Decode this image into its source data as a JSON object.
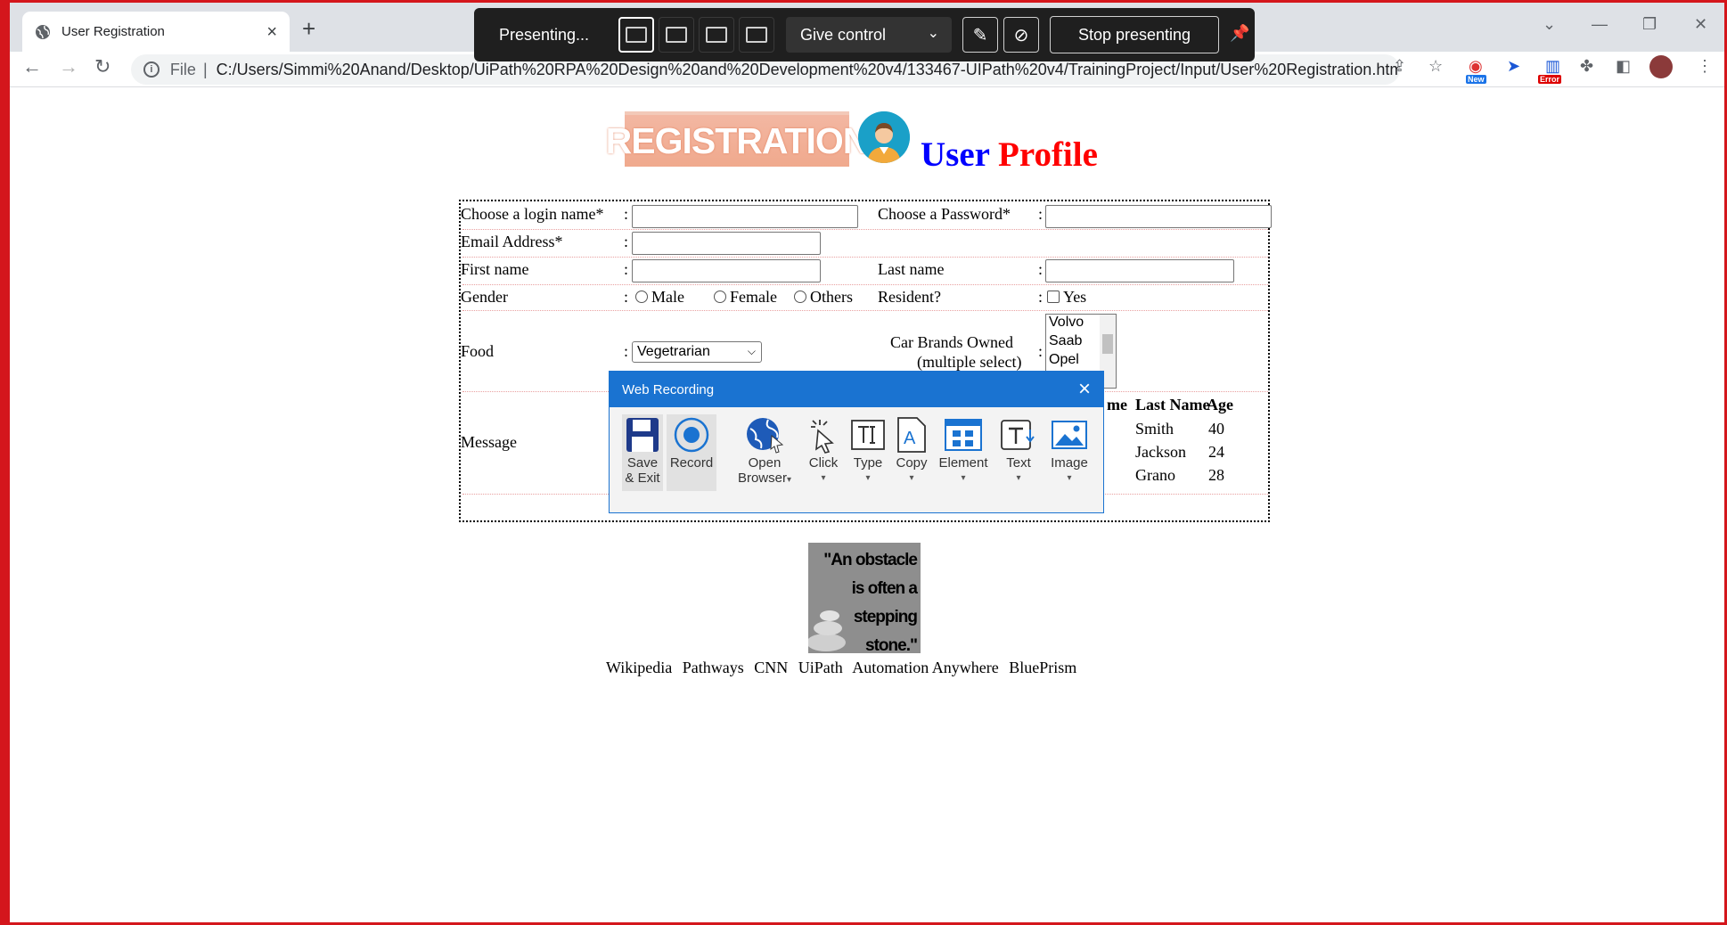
{
  "browser": {
    "tab_title": "User Registration",
    "new_tab": "+",
    "file_label": "File",
    "url": "C:/Users/Simmi%20Anand/Desktop/UiPath%20RPA%20Design%20and%20Development%20v4/133467-UIPath%20v4/TrainingProject/Input/User%20Registration.html",
    "ext_new_badge": "New",
    "ext_error_badge": "Error"
  },
  "presenting": {
    "status": "Presenting...",
    "give_control": "Give control",
    "stop": "Stop presenting"
  },
  "page": {
    "banner": "REGISTRATION",
    "title_word1": "User",
    "title_word2": "Profile",
    "form": {
      "login_label": "Choose a login name*",
      "password_label": "Choose a Password*",
      "email_label": "Email Address*",
      "first_name_label": "First name",
      "last_name_label": "Last name",
      "gender_label": "Gender",
      "gender_options": [
        "Male",
        "Female",
        "Others"
      ],
      "resident_label": "Resident?",
      "resident_option": "Yes",
      "food_label": "Food",
      "food_selected": "Vegetrarian",
      "car_label_1": "Car Brands Owned",
      "car_label_2": "(multiple select)",
      "car_options": [
        "Volvo",
        "Saab",
        "Opel"
      ],
      "message_label": "Message",
      "colon": ":"
    },
    "mini_table": {
      "headers": [
        "me",
        "Last Name",
        "Age"
      ],
      "rows": [
        [
          "Smith",
          "40"
        ],
        [
          "Jackson",
          "24"
        ],
        [
          "Grano",
          "28"
        ]
      ]
    },
    "quote": [
      "\"An obstacle",
      "is often a",
      "stepping",
      "stone.\""
    ],
    "links": [
      "Wikipedia",
      "Pathways",
      "CNN",
      "UiPath",
      "Automation Anywhere",
      "BluePrism"
    ]
  },
  "recorder": {
    "title": "Web Recording",
    "buttons": {
      "save_1": "Save",
      "save_2": "& Exit",
      "record": "Record",
      "open_1": "Open",
      "open_2": "Browser",
      "click": "Click",
      "type": "Type",
      "copy": "Copy",
      "element": "Element",
      "text": "Text",
      "image": "Image"
    }
  }
}
